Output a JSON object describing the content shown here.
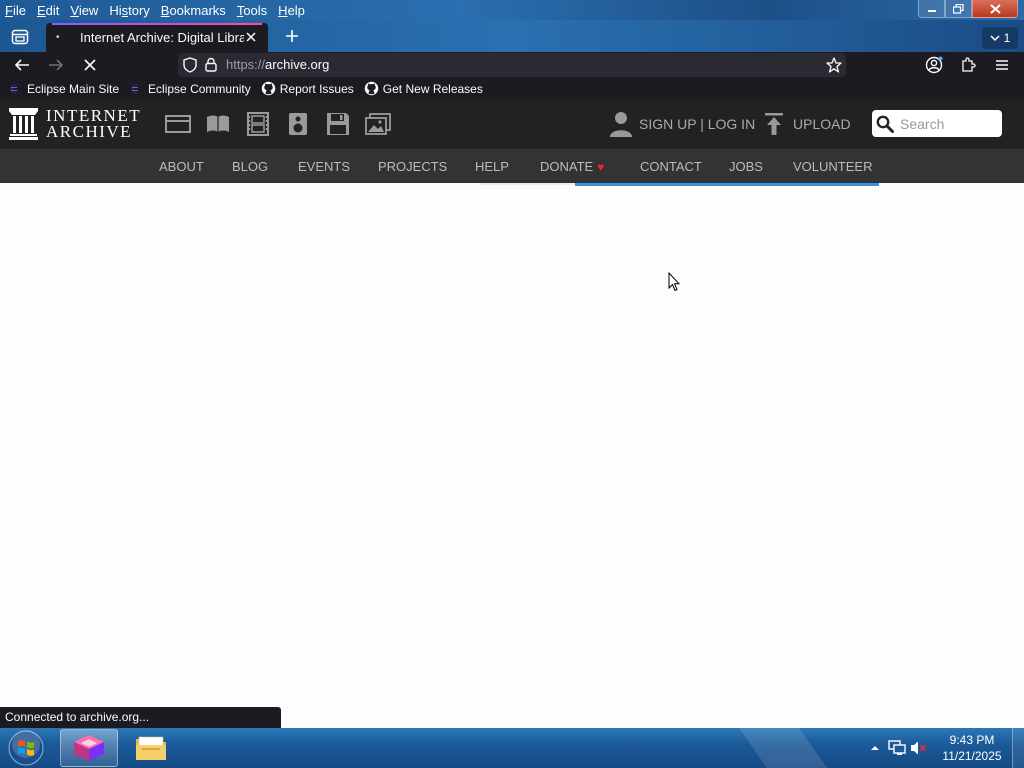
{
  "menubar": {
    "items": [
      {
        "pre": "",
        "u": "F",
        "post": "ile"
      },
      {
        "pre": "",
        "u": "E",
        "post": "dit"
      },
      {
        "pre": "",
        "u": "V",
        "post": "iew"
      },
      {
        "pre": "Hi",
        "u": "s",
        "post": "tory"
      },
      {
        "pre": "",
        "u": "B",
        "post": "ookmarks"
      },
      {
        "pre": "",
        "u": "T",
        "post": "ools"
      },
      {
        "pre": "",
        "u": "H",
        "post": "elp"
      }
    ]
  },
  "tabs": {
    "active_title": "Internet Archive: Digital Library",
    "count": "1"
  },
  "urlbar": {
    "scheme": "https://",
    "host": "archive.org"
  },
  "bookmarks": [
    {
      "label": "Eclipse Main Site",
      "icon": "eclipse-icon"
    },
    {
      "label": "Eclipse Community",
      "icon": "eclipse-icon"
    },
    {
      "label": "Report Issues",
      "icon": "github-icon"
    },
    {
      "label": "Get New Releases",
      "icon": "github-icon"
    }
  ],
  "ia": {
    "logo_line1": "INTERNET",
    "logo_line2": "ARCHIVE",
    "signup_label": "SIGN UP | LOG IN",
    "upload_label": "UPLOAD",
    "search_placeholder": "Search",
    "nav": [
      "ABOUT",
      "BLOG",
      "EVENTS",
      "PROJECTS",
      "HELP",
      "DONATE",
      "CONTACT",
      "JOBS",
      "VOLUNTEER"
    ],
    "donate_heart": "♥"
  },
  "status": {
    "text": "Connected to archive.org..."
  },
  "taskbar": {
    "time": "9:43 PM",
    "date": "11/21/2025"
  },
  "colors": {
    "ia_header": "#222222",
    "ia_nav": "#333333",
    "firefox_dark": "#1c1b22",
    "load_bar": "#3b8fe0",
    "donate_heart": "#e2243c"
  }
}
